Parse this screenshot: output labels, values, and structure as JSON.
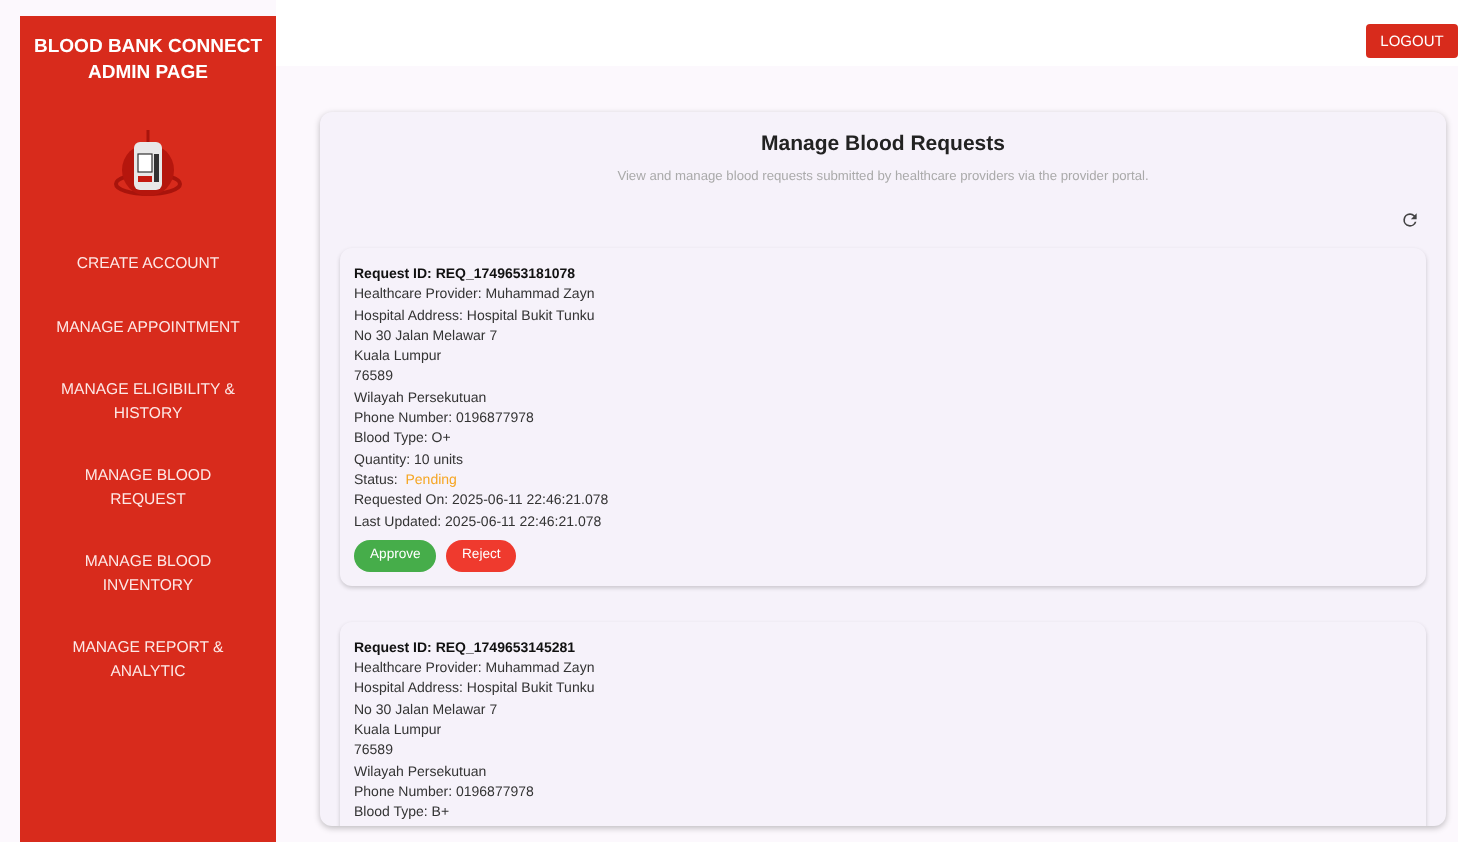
{
  "sidebar": {
    "title": "BLOOD BANK CONNECT ADMIN PAGE",
    "items": [
      {
        "label": "CREATE ACCOUNT"
      },
      {
        "label": "MANAGE APPOINTMENT"
      },
      {
        "label": "MANAGE ELIGIBILITY & HISTORY"
      },
      {
        "label": "MANAGE BLOOD REQUEST"
      },
      {
        "label": "MANAGE BLOOD INVENTORY"
      },
      {
        "label": "MANAGE REPORT & ANALYTIC"
      }
    ]
  },
  "header": {
    "logout": "LOGOUT"
  },
  "panel": {
    "title": "Manage Blood Requests",
    "subtitle": "View and manage blood requests submitted by healthcare providers via the provider portal.",
    "requests": [
      {
        "id": "Request ID: REQ_1749653181078",
        "lines": [
          {
            "kind": "plain",
            "text": "Healthcare Provider: Muhammad Zayn"
          },
          {
            "kind": "plain",
            "text": "Hospital Address: Hospital Bukit Tunku"
          },
          {
            "kind": "plain",
            "text": "No 30 Jalan Melawar 7"
          },
          {
            "kind": "plain",
            "text": "Kuala Lumpur"
          },
          {
            "kind": "plain",
            "text": "76589"
          },
          {
            "kind": "plain",
            "text": "Wilayah Persekutuan"
          },
          {
            "kind": "plain",
            "text": "Phone Number: 0196877978"
          },
          {
            "kind": "plain",
            "text": "Blood Type: O+"
          },
          {
            "kind": "plain",
            "text": "Quantity: 10 units"
          },
          {
            "kind": "status",
            "label": "Status:",
            "text": "Pending",
            "color": "#f5a623"
          },
          {
            "kind": "plain",
            "text": "Requested On: 2025-06-11 22:46:21.078"
          },
          {
            "kind": "plain",
            "text": "Last Updated: 2025-06-11 22:46:21.078"
          }
        ],
        "actions": [
          {
            "kind": "approve",
            "label": "Approve"
          },
          {
            "kind": "reject",
            "label": "Reject"
          }
        ]
      },
      {
        "id": "Request ID: REQ_1749653145281",
        "lines": [
          {
            "kind": "plain",
            "text": "Healthcare Provider: Muhammad Zayn"
          },
          {
            "kind": "plain",
            "text": "Hospital Address: Hospital Bukit Tunku"
          },
          {
            "kind": "plain",
            "text": "No 30 Jalan Melawar 7"
          },
          {
            "kind": "plain",
            "text": "Kuala Lumpur"
          },
          {
            "kind": "plain",
            "text": "76589"
          },
          {
            "kind": "plain",
            "text": "Wilayah Persekutuan"
          },
          {
            "kind": "plain",
            "text": "Phone Number: 0196877978"
          },
          {
            "kind": "plain",
            "text": "Blood Type: B+"
          }
        ]
      }
    ]
  }
}
